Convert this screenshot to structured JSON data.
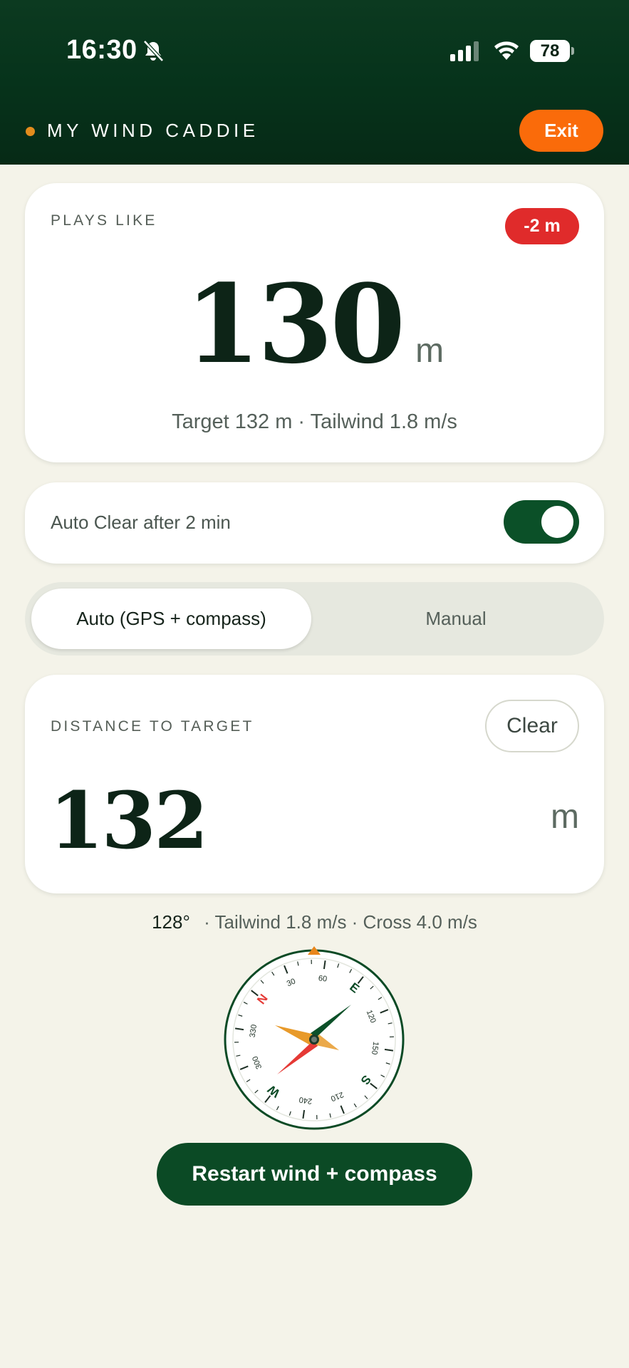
{
  "status_bar": {
    "time": "16:30",
    "battery": "78",
    "icons": [
      "bell-slash-icon",
      "cellular-signal-icon",
      "wifi-icon",
      "battery-icon"
    ]
  },
  "header": {
    "title": "MY WIND CADDIE",
    "exit_label": "Exit",
    "accent_color": "#e38c1d",
    "exit_color": "#fa6b0a"
  },
  "plays_like": {
    "label": "PLAYS LIKE",
    "delta_badge": "-2 m",
    "value": "130",
    "unit": "m",
    "subtitle": "Target 132 m · Tailwind 1.8 m/s",
    "badge_color": "#e02b2b"
  },
  "auto_clear": {
    "label": "Auto Clear after 2 min",
    "enabled": true,
    "toggle_color": "#0b5028"
  },
  "mode": {
    "options": [
      "Auto (GPS + compass)",
      "Manual"
    ],
    "selected": "Auto (GPS + compass)"
  },
  "distance": {
    "label": "DISTANCE TO TARGET",
    "clear_label": "Clear",
    "value": "132",
    "unit": "m"
  },
  "wind": {
    "heading": "128°",
    "details": "· Tailwind 1.8 m/s · Cross 4.0 m/s"
  },
  "compass": {
    "heading_deg": 128,
    "cardinals": [
      "N",
      "E",
      "S",
      "W"
    ],
    "degree_labels": [
      "30",
      "60",
      "120",
      "150",
      "210",
      "240",
      "300",
      "330"
    ],
    "colors": {
      "ring": "#0b4a25",
      "north": "#e53935",
      "wind": "#e89a2a",
      "marker": "#e8861b"
    }
  },
  "restart_label": "Restart wind + compass"
}
